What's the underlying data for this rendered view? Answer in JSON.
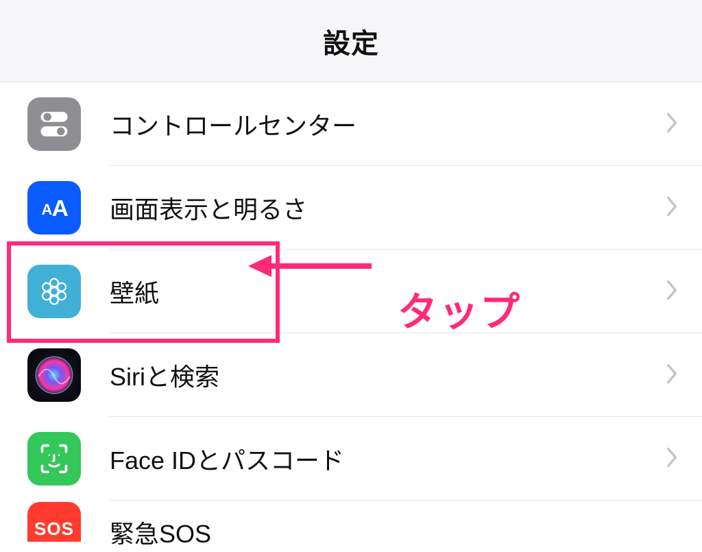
{
  "header": {
    "title": "設定"
  },
  "rows": {
    "control_center": {
      "label": "コントロールセンター"
    },
    "display": {
      "label": "画面表示と明るさ"
    },
    "wallpaper": {
      "label": "壁紙"
    },
    "siri": {
      "label": "Siriと検索"
    },
    "faceid": {
      "label": "Face IDとパスコード"
    },
    "sos": {
      "label": "緊急SOS",
      "icon_text": "SOS"
    }
  },
  "annotation": {
    "tap_label": "タップ"
  },
  "colors": {
    "highlight": "#ff2a78",
    "blue": "#007aff",
    "lightblue": "#4fb5d0",
    "green": "#34c759",
    "red": "#ff3b30",
    "gray": "#8e8e93"
  }
}
